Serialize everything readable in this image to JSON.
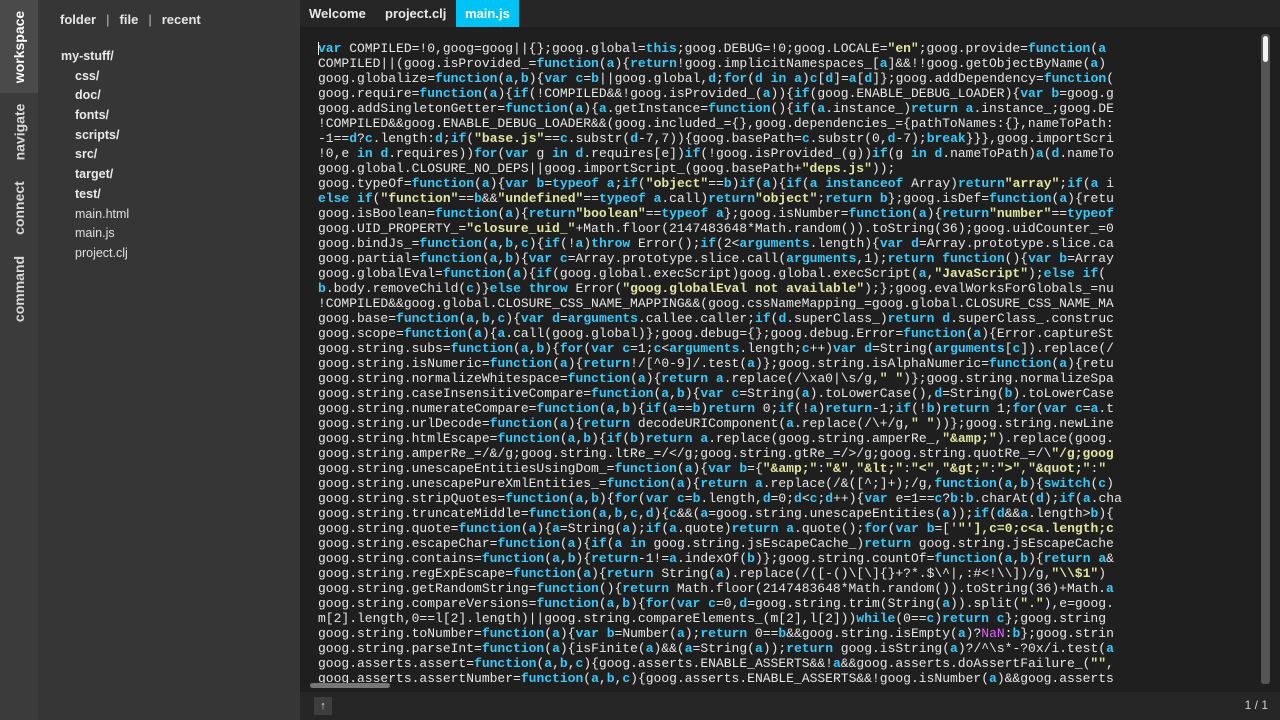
{
  "rail": {
    "workspace": "workspace",
    "navigate": "navigate",
    "connect": "connect",
    "command": "command"
  },
  "sidebar": {
    "tabs": [
      "folder",
      "file",
      "recent"
    ],
    "separator": "|",
    "tree": [
      {
        "label": "my-stuff/",
        "level": 0,
        "type": "folder"
      },
      {
        "label": "css/",
        "level": 1,
        "type": "folder"
      },
      {
        "label": "doc/",
        "level": 1,
        "type": "folder"
      },
      {
        "label": "fonts/",
        "level": 1,
        "type": "folder"
      },
      {
        "label": "scripts/",
        "level": 1,
        "type": "folder"
      },
      {
        "label": "src/",
        "level": 1,
        "type": "folder"
      },
      {
        "label": "target/",
        "level": 1,
        "type": "folder"
      },
      {
        "label": "test/",
        "level": 1,
        "type": "folder"
      },
      {
        "label": "main.html",
        "level": 1,
        "type": "file"
      },
      {
        "label": "main.js",
        "level": 1,
        "type": "file"
      },
      {
        "label": "project.clj",
        "level": 1,
        "type": "file"
      }
    ]
  },
  "editor": {
    "tabs": [
      {
        "label": "Welcome",
        "active": false
      },
      {
        "label": "project.clj",
        "active": false
      },
      {
        "label": "main.js",
        "active": true
      }
    ],
    "accent_color": "#00c3f5",
    "code_lines": [
      "var COMPILED=!0,goog=goog||{};goog.global=this;goog.DEBUG=!0;goog.LOCALE=\"en\";goog.provide=function(a",
      "COMPILED||(goog.isProvided_=function(a){return!goog.implicitNamespaces_[a]&&!!goog.getObjectByName(a)",
      "goog.globalize=function(a,b){var c=b||goog.global,d;for(d in a)c[d]=a[d]};goog.addDependency=function(",
      "goog.require=function(a){if(!COMPILED&&!goog.isProvided_(a)){if(goog.ENABLE_DEBUG_LOADER){var b=goog.g",
      "goog.addSingletonGetter=function(a){a.getInstance=function(){if(a.instance_)return a.instance_;goog.DE",
      "!COMPILED&&goog.ENABLE_DEBUG_LOADER&&(goog.included_={},goog.dependencies_={pathToNames:{},nameToPath:",
      "-1==d?c.length:d;if(\"base.js\"==c.substr(d-7,7)){goog.basePath=c.substr(0,d-7);break}}},goog.importScri",
      "!0,e in d.requires))for(var g in d.requires[e])if(!goog.isProvided_(g))if(g in d.nameToPath)a(d.nameTo",
      "goog.global.CLOSURE_NO_DEPS||goog.importScript_(goog.basePath+\"deps.js\"));",
      "goog.typeOf=function(a){var b=typeof a;if(\"object\"==b)if(a){if(a instanceof Array)return\"array\";if(a i",
      "else if(\"function\"==b&&\"undefined\"==typeof a.call)return\"object\";return b};goog.isDef=function(a){retu",
      "goog.isBoolean=function(a){return\"boolean\"==typeof a};goog.isNumber=function(a){return\"number\"==typeof",
      "goog.UID_PROPERTY_=\"closure_uid_\"+Math.floor(2147483648*Math.random()).toString(36);goog.uidCounter_=0",
      "goog.bindJs_=function(a,b,c){if(!a)throw Error();if(2<arguments.length){var d=Array.prototype.slice.ca",
      "goog.partial=function(a,b){var c=Array.prototype.slice.call(arguments,1);return function(){var b=Array",
      "goog.globalEval=function(a){if(goog.global.execScript)goog.global.execScript(a,\"JavaScript\");else if(",
      "b.body.removeChild(c)}else throw Error(\"goog.globalEval not available\");};goog.evalWorksForGlobals_=nu",
      "!COMPILED&&goog.global.CLOSURE_CSS_NAME_MAPPING&&(goog.cssNameMapping_=goog.global.CLOSURE_CSS_NAME_MA",
      "goog.base=function(a,b,c){var d=arguments.callee.caller;if(d.superClass_)return d.superClass_.construc",
      "goog.scope=function(a){a.call(goog.global)};goog.debug={};goog.debug.Error=function(a){Error.captureSt",
      "goog.string.subs=function(a,b){for(var c=1;c<arguments.length;c++)var d=String(arguments[c]).replace(/",
      "goog.string.isNumeric=function(a){return!/[^0-9]/.test(a)};goog.string.isAlphaNumeric=function(a){retu",
      "goog.string.normalizeWhitespace=function(a){return a.replace(/\\xa0|\\s/g,\" \")};goog.string.normalizeSpa",
      "goog.string.caseInsensitiveCompare=function(a,b){var c=String(a).toLowerCase(),d=String(b).toLowerCase",
      "goog.string.numerateCompare=function(a,b){if(a==b)return 0;if(!a)return-1;if(!b)return 1;for(var c=a.t",
      "goog.string.urlDecode=function(a){return decodeURIComponent(a.replace(/\\+/g,\" \"))};goog.string.newLine",
      "goog.string.htmlEscape=function(a,b){if(b)return a.replace(goog.string.amperRe_,\"&amp;\").replace(goog.",
      "goog.string.amperRe_=/&/g;goog.string.ltRe_=/</g;goog.string.gtRe_=/>/g;goog.string.quotRe_=/\\\"/g;goog",
      "goog.string.unescapeEntitiesUsingDom_=function(a){var b={\"&amp;\":\"&\",\"&lt;\":\"<\",\"&gt;\":\">\",\"&quot;\":\"",
      "goog.string.unescapePureXmlEntities_=function(a){return a.replace(/&([^;]+);/g,function(a,b){switch(c)",
      "goog.string.stripQuotes=function(a,b){for(var c=b.length,d=0;d<c;d++){var e=1==c?b:b.charAt(d);if(a.cha",
      "goog.string.truncateMiddle=function(a,b,c,d){c&&(a=goog.string.unescapeEntities(a));if(d&&a.length>b){",
      "goog.string.quote=function(a){a=String(a);if(a.quote)return a.quote();for(var b=['\"'],c=0;c<a.length;c",
      "goog.string.escapeChar=function(a){if(a in goog.string.jsEscapeCache_)return goog.string.jsEscapeCache",
      "goog.string.contains=function(a,b){return-1!=a.indexOf(b)};goog.string.countOf=function(a,b){return a&",
      "goog.string.regExpEscape=function(a){return String(a).replace(/([-()\\[\\]{}+?*.$\\^|,:#<!\\\\])/g,\"\\\\$1\")",
      "goog.string.getRandomString=function(){return Math.floor(2147483648*Math.random()).toString(36)+Math.a",
      "goog.string.compareVersions=function(a,b){for(var c=0,d=goog.string.trim(String(a)).split(\".\"),e=goog.",
      "m[2].length,0==l[2].length)||goog.string.compareElements_(m[2],l[2]))while(0==c)return c};goog.string",
      "goog.string.toNumber=function(a){var b=Number(a);return 0==b&&goog.string.isEmpty(a)?NaN:b};goog.strin",
      "goog.string.parseInt=function(a){isFinite(a)&&(a=String(a));return goog.isString(a)?/^\\s*-?0x/i.test(a",
      "goog.asserts.assert=function(a,b,c){goog.asserts.ENABLE_ASSERTS&&!a&&goog.asserts.doAssertFailure_(\"\",",
      "goog.asserts.assertNumber=function(a,b,c){goog.asserts.ENABLE_ASSERTS&&!goog.isNumber(a)&&goog.asserts"
    ]
  },
  "status": {
    "button_glyph": "↑",
    "page": "1 / 1"
  }
}
